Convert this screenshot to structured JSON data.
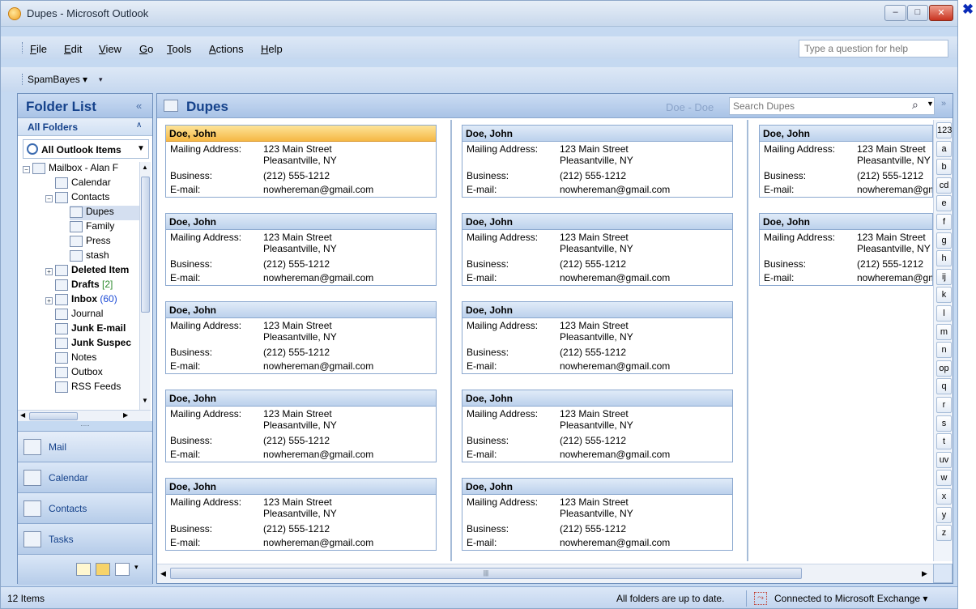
{
  "window": {
    "title": "Dupes - Microsoft Outlook",
    "min": "–",
    "max": "□",
    "close": "✕",
    "outer_close": "✖"
  },
  "menu": [
    {
      "pre": "",
      "u": "F",
      "post": "ile"
    },
    {
      "pre": "",
      "u": "E",
      "post": "dit"
    },
    {
      "pre": "",
      "u": "V",
      "post": "iew"
    },
    {
      "pre": "",
      "u": "G",
      "post": "o"
    },
    {
      "pre": "",
      "u": "T",
      "post": "ools"
    },
    {
      "pre": "",
      "u": "A",
      "post": "ctions"
    },
    {
      "pre": "",
      "u": "H",
      "post": "elp"
    }
  ],
  "help_placeholder": "Type a question for help",
  "toolbar": {
    "spambayes": "SpamBayes ▾",
    "chevron": "▾"
  },
  "nav": {
    "title": "Folder List",
    "collapse": "«",
    "all_folders": "All Folders",
    "all_folders_chev": "∧",
    "all_items": "All Outlook Items",
    "all_items_arrow": "▼",
    "tree": [
      {
        "label": "Mailbox - Alan F",
        "bold": false
      },
      {
        "label": "Calendar",
        "bold": false
      },
      {
        "label": "Contacts",
        "bold": false
      },
      {
        "label": "Dupes",
        "bold": false
      },
      {
        "label": "Family",
        "bold": false
      },
      {
        "label": "Press",
        "bold": false
      },
      {
        "label": "stash",
        "bold": false
      },
      {
        "label": "Deleted Item",
        "bold": true
      },
      {
        "label": "Drafts",
        "bold": true,
        "count": "[2]"
      },
      {
        "label": "Inbox",
        "bold": true,
        "count": "(60)"
      },
      {
        "label": "Journal",
        "bold": false
      },
      {
        "label": "Junk E-mail",
        "bold": true
      },
      {
        "label": "Junk Suspec",
        "bold": true
      },
      {
        "label": "Notes",
        "bold": false
      },
      {
        "label": "Outbox",
        "bold": false
      },
      {
        "label": "RSS Feeds",
        "bold": false
      }
    ],
    "splitter": ".....",
    "buttons": {
      "mail": "Mail",
      "calendar": "Calendar",
      "contacts": "Contacts",
      "tasks": "Tasks"
    }
  },
  "main": {
    "folder": "Dupes",
    "range": "Doe - Doe",
    "search_placeholder": "Search Dupes",
    "search_icon": "⌕",
    "search_arrow": "▼",
    "expand": "»",
    "labels": {
      "mailing": "Mailing Address:",
      "business": "Business:",
      "email": "E-mail:"
    },
    "cards": [
      {
        "name": "Doe, John",
        "street": "123 Main Street",
        "city": "Pleasantville, NY",
        "phone": "(212) 555-1212",
        "email": "nowhereman@gmail.com"
      },
      {
        "name": "Doe, John",
        "street": "123 Main Street",
        "city": "Pleasantville, NY",
        "phone": "(212) 555-1212",
        "email": "nowhereman@gmail.com"
      },
      {
        "name": "Doe, John",
        "street": "123 Main Street",
        "city": "Pleasantville, NY",
        "phone": "(212) 555-1212",
        "email": "nowhereman@gmail.com"
      },
      {
        "name": "Doe, John",
        "street": "123 Main Street",
        "city": "Pleasantville, NY",
        "phone": "(212) 555-1212",
        "email": "nowhereman@gmail.com"
      },
      {
        "name": "Doe, John",
        "street": "123 Main Street",
        "city": "Pleasantville, NY",
        "phone": "(212) 555-1212",
        "email": "nowhereman@gmail.com"
      },
      {
        "name": "Doe, John",
        "street": "123 Main Street",
        "city": "Pleasantville, NY",
        "phone": "(212) 555-1212",
        "email": "nowhereman@gmail.com"
      },
      {
        "name": "Doe, John",
        "street": "123 Main Street",
        "city": "Pleasantville, NY",
        "phone": "(212) 555-1212",
        "email": "nowhereman@gmail.com"
      },
      {
        "name": "Doe, John",
        "street": "123 Main Street",
        "city": "Pleasantville, NY",
        "phone": "(212) 555-1212",
        "email": "nowhereman@gmail.com"
      },
      {
        "name": "Doe, John",
        "street": "123 Main Street",
        "city": "Pleasantville, NY",
        "phone": "(212) 555-1212",
        "email": "nowhereman@gmail.com"
      },
      {
        "name": "Doe, John",
        "street": "123 Main Street",
        "city": "Pleasantville, NY",
        "phone": "(212) 555-1212",
        "email": "nowhereman@gmail.com"
      },
      {
        "name": "Doe, John",
        "street": "123 Main Street",
        "city": "Pleasantville, NY",
        "phone": "(212) 555-1212",
        "email": "nowhereman@gmail.com"
      },
      {
        "name": "Doe, John",
        "street": "123 Main Street",
        "city": "Pleasantville, NY",
        "phone": "(212) 555-1212",
        "email": "nowhereman@gmail.com"
      }
    ],
    "alpha": [
      "123",
      "a",
      "b",
      "cd",
      "e",
      "f",
      "g",
      "h",
      "ij",
      "k",
      "l",
      "m",
      "n",
      "op",
      "q",
      "r",
      "s",
      "t",
      "uv",
      "w",
      "x",
      "y",
      "z"
    ]
  },
  "status": {
    "items": "12 Items",
    "sync": "All folders are up to date.",
    "exchange": "Connected to Microsoft Exchange ▾"
  },
  "colors": {
    "selected_card": "#f5b845",
    "accent": "#15428b"
  }
}
